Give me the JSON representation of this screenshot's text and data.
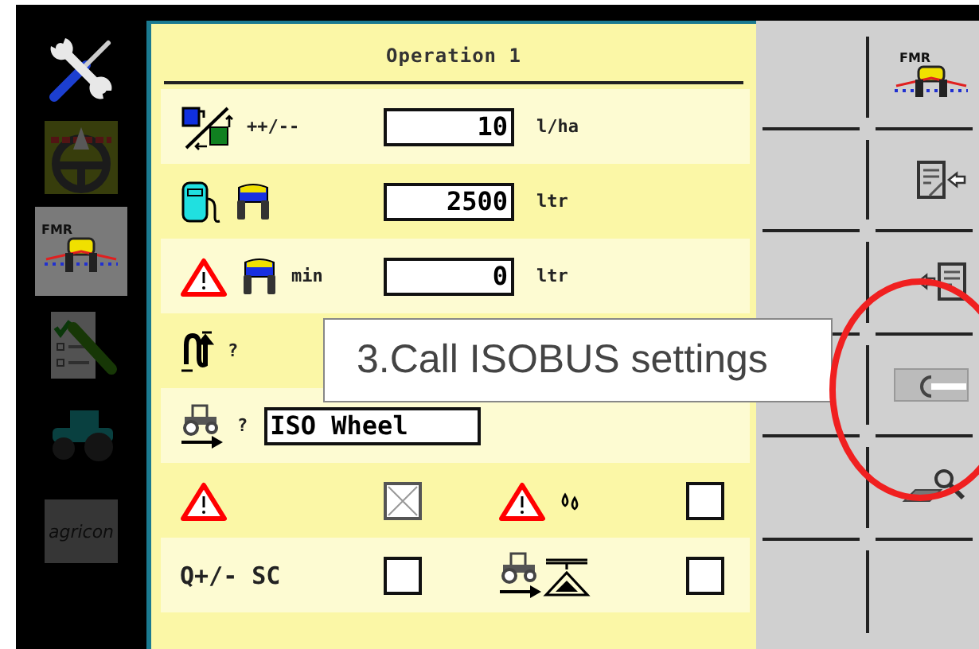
{
  "sidebar": {
    "items": [
      {
        "kind": "tools",
        "selected": false,
        "dimmed": false
      },
      {
        "kind": "steering",
        "selected": false,
        "dimmed": true
      },
      {
        "kind": "sprayer",
        "label": "FMR",
        "selected": true,
        "dimmed": false
      },
      {
        "kind": "checklist",
        "selected": false,
        "dimmed": true
      },
      {
        "kind": "tractor",
        "selected": false,
        "dimmed": true
      },
      {
        "kind": "logo",
        "label": "agricon",
        "selected": false,
        "dimmed": true
      }
    ]
  },
  "panel": {
    "title": "Operation 1",
    "rows": [
      {
        "kind": "field",
        "label": "++/--",
        "value": "10",
        "unit": "l/ha"
      },
      {
        "kind": "field",
        "value": "2500",
        "unit": "ltr"
      },
      {
        "kind": "field",
        "label": "min",
        "value": "0",
        "unit": "ltr"
      },
      {
        "kind": "hidden",
        "label": "?"
      },
      {
        "kind": "wide",
        "label": "?",
        "value": "ISO Wheel"
      },
      {
        "kind": "checks",
        "items": [
          {
            "checked": true
          },
          {
            "checked": false
          }
        ]
      },
      {
        "kind": "checks",
        "items": [
          {
            "label": "Q+/- SC",
            "checked": false
          },
          {
            "checked": false
          }
        ]
      }
    ]
  },
  "softkeys": [
    {
      "kind": "sprayer",
      "label": "FMR"
    },
    {
      "kind": "export"
    },
    {
      "kind": "import"
    },
    {
      "kind": "isobus"
    },
    {
      "kind": "eraser-search"
    }
  ],
  "annotation": {
    "text": "3.Call ISOBUS settings"
  }
}
